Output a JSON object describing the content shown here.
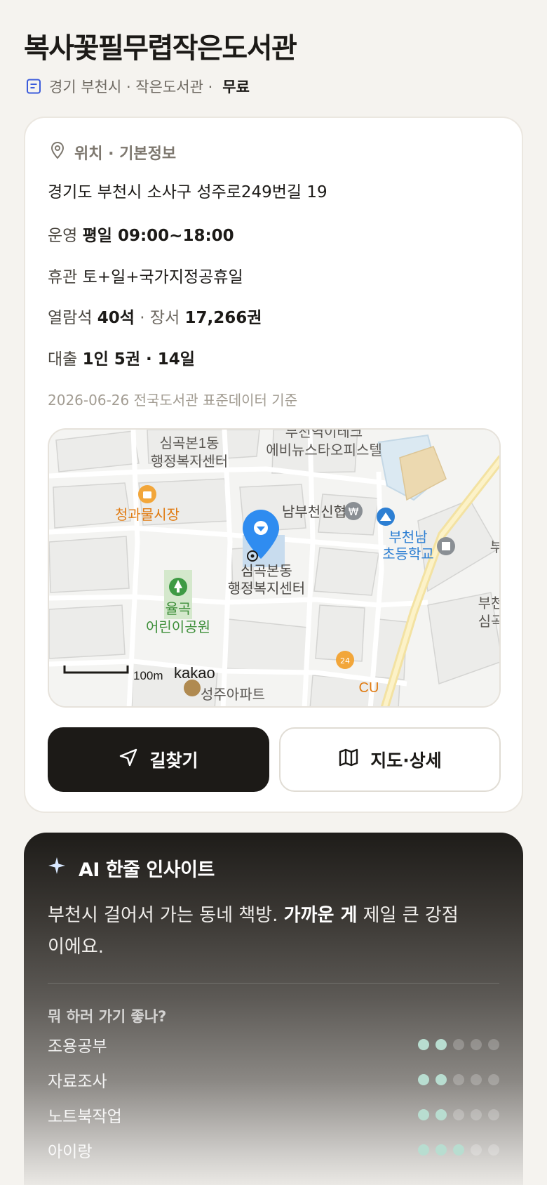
{
  "header": {
    "title": "복사꽃필무렵작은도서관",
    "subtitle_location": "경기 부천시 · 작은도서관 ·",
    "subtitle_fee": "무료"
  },
  "info": {
    "section_title": "위치 · 기본정보",
    "address": "경기도 부천시 소사구 성주로249번길 19",
    "hours_label": "운영",
    "hours_value": "평일 09:00~18:00",
    "closed_label": "휴관",
    "closed_value": "토+일+국가지정공휴일",
    "seats_label": "열람석",
    "seats_value": "40석",
    "books_sep": "· 장서",
    "books_value": "17,266권",
    "loan_label": "대출",
    "loan_value": "1인 5권 · 14일",
    "source": "2026-06-26 전국도서관 표준데이터 기준"
  },
  "map": {
    "labels": {
      "center_1": "심곡본1동",
      "center_1b": "행정복지센터",
      "office_1": "부천역이테크",
      "office_2": "에비뉴스타오피스텔",
      "market": "청과물시장",
      "bank": "남부천신협",
      "school_1": "부천남",
      "school_2": "초등학교",
      "edge_1": "부",
      "center_2": "심곡본동",
      "center_2b": "행정복지센터",
      "park_1": "율곡",
      "park_2": "어린이공원",
      "edge_2": "부천",
      "edge_3": "심곡",
      "scale": "100m",
      "brand": "kakao",
      "store": "CU",
      "bottom": "성주아파트"
    },
    "colors": {
      "pin": "#2f8cf0",
      "market": "#e07b12",
      "park": "#3e8f3a",
      "school": "#2d7fd3",
      "road_main": "#fbe7a0"
    }
  },
  "buttons": {
    "directions": "길찾기",
    "map_detail": "지도·상세"
  },
  "ai": {
    "title": "AI 한줄 인사이트",
    "text_1": "부천시 걸어서 가는 동네 책방. ",
    "text_bold": "가까운 게",
    "text_2": " 제일 큰 강점이에요.",
    "question": "뭐 하러 가기 좋나?",
    "activities": [
      {
        "name": "조용공부",
        "level": 2,
        "max": 5
      },
      {
        "name": "자료조사",
        "level": 2,
        "max": 5
      },
      {
        "name": "노트북작업",
        "level": 2,
        "max": 5
      },
      {
        "name": "아이랑",
        "level": 3,
        "max": 5
      }
    ],
    "accent": "#b8ddd0"
  }
}
